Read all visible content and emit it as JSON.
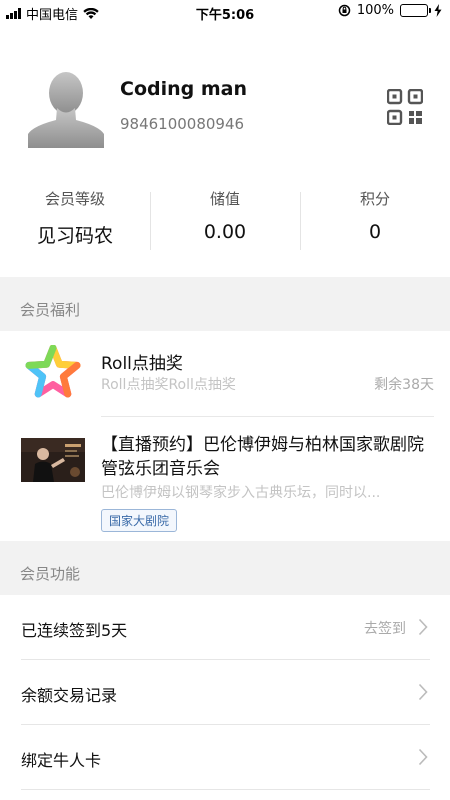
{
  "status_bar": {
    "carrier": "中国电信",
    "time": "下午5:06",
    "battery": "100%"
  },
  "profile": {
    "name": "Coding man",
    "phone": "9846100080946"
  },
  "stats": [
    {
      "label": "会员等级",
      "value": "见习码农"
    },
    {
      "label": "储值",
      "value": "0.00"
    },
    {
      "label": "积分",
      "value": "0"
    }
  ],
  "benefits_section": {
    "title": "会员福利"
  },
  "benefits": [
    {
      "title": "Roll点抽奖",
      "subtitle": "Roll点抽奖Roll点抽奖",
      "remaining": "剩余38天",
      "icon": "star-icon"
    },
    {
      "title": "【直播预约】巴伦博伊姆与柏林国家歌剧院管弦乐团音乐会",
      "subtitle": "巴伦博伊姆以钢琴家步入古典乐坛，同时以...",
      "tag": "国家大剧院",
      "icon": "concert-thumbnail"
    }
  ],
  "functions_section": {
    "title": "会员功能"
  },
  "functions": [
    {
      "label": "已连续签到5天",
      "extra": "去签到"
    },
    {
      "label": "余额交易记录",
      "extra": ""
    },
    {
      "label": "绑定牛人卡",
      "extra": ""
    }
  ],
  "colors": {
    "section_bg": "#f2f2f2",
    "battery_green": "#4cd964",
    "tag_blue": "#3a6aa8"
  }
}
